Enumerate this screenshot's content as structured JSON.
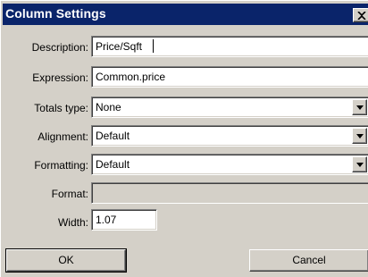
{
  "window": {
    "title": "Column Settings",
    "close_icon": "close-icon"
  },
  "form": {
    "description_label": "Description:",
    "description_value": "Price/Sqft",
    "expression_label": "Expression:",
    "expression_value": "Common.price",
    "totals_label": "Totals type:",
    "totals_value": "None",
    "alignment_label": "Alignment:",
    "alignment_value": "Default",
    "formatting_label": "Formatting:",
    "formatting_value": "Default",
    "format_label": "Format:",
    "format_value": "",
    "width_label": "Width:",
    "width_value": "1.07"
  },
  "buttons": {
    "ok_label": "OK",
    "cancel_label": "Cancel"
  },
  "colors": {
    "titlebar": "#0a246a",
    "dialog_face": "#d4d0c8"
  }
}
